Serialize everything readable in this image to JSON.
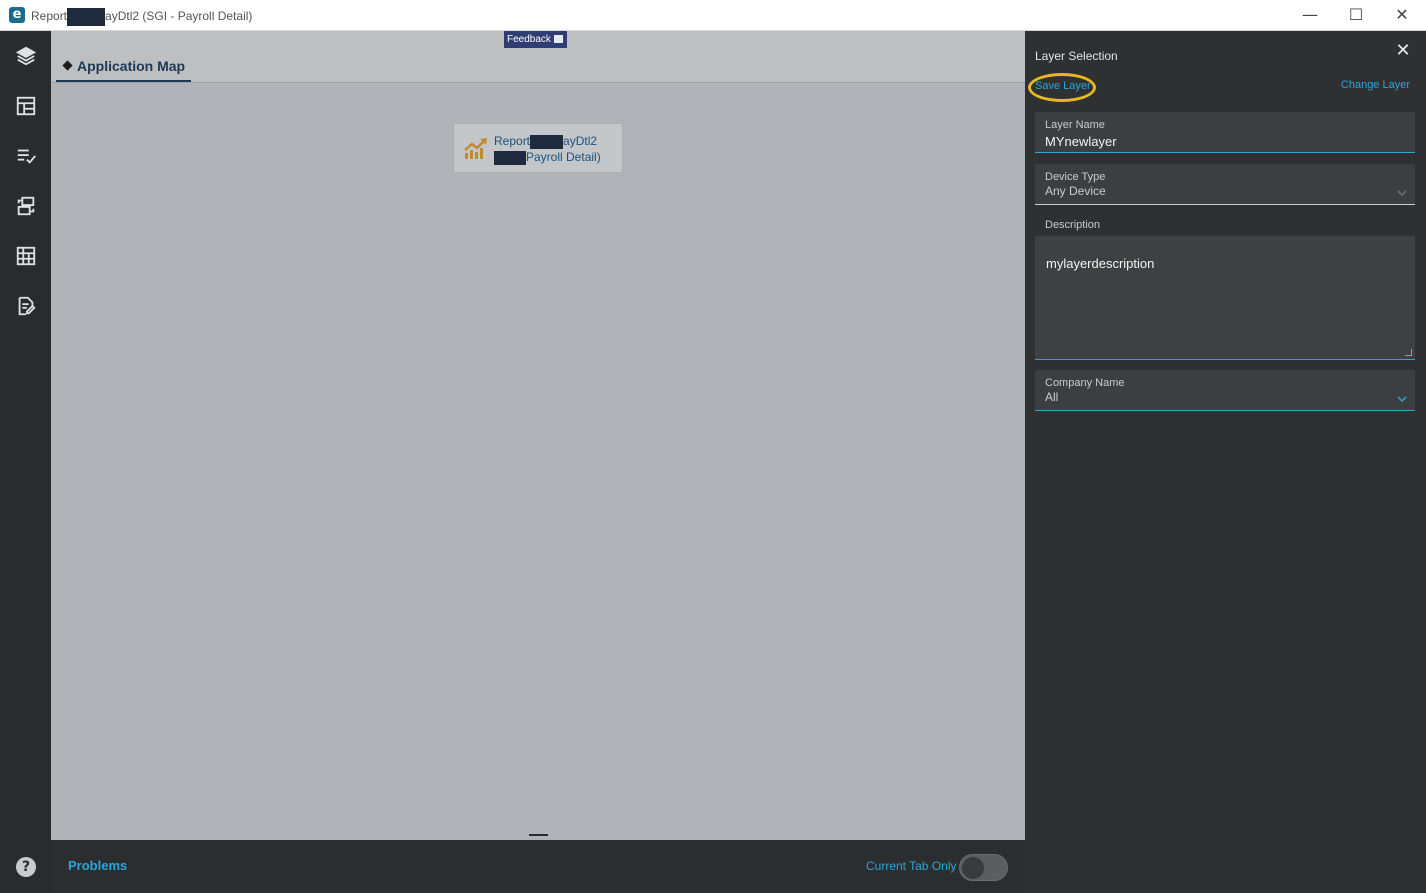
{
  "window": {
    "title_prefix": "Report",
    "title_suffix": "ayDtl2 (SGI - Payroll Detail)",
    "minimize_glyph": "—",
    "maximize_glyph": "☐",
    "close_glyph": "✕",
    "logo_glyph": "e"
  },
  "rail": {
    "icons": [
      "layers-icon",
      "layout-icon",
      "checklist-icon",
      "transfer-icon",
      "table-grid-icon",
      "edit-document-icon"
    ],
    "help_glyph": "?"
  },
  "main": {
    "feedback_label": "Feedback",
    "tab_label": "Application Map",
    "node": {
      "line1_prefix": "Report",
      "line1_suffix": "ayDtl2",
      "line2_suffix": "Payroll Detail)",
      "icon": "trend-up-icon",
      "icon_color": "#c08a2e"
    }
  },
  "bottom": {
    "problems_label": "Problems",
    "current_tab_label": "Current Tab Only",
    "toggle_on": false
  },
  "panel": {
    "title": "Layer Selection",
    "close_glyph": "✕",
    "save_layer": "Save Layer",
    "change_layer": "Change Layer",
    "layer_name": {
      "label": "Layer Name",
      "value": "MYnewlayer"
    },
    "device_type": {
      "label": "Device Type",
      "value": "Any Device"
    },
    "description": {
      "label": "Description",
      "value": "mylayerdescription"
    },
    "company_name": {
      "label": "Company Name",
      "value": "All"
    }
  },
  "colors": {
    "accent": "#2aa6d9",
    "highlight_ring": "#e8b820",
    "rail_bg": "#2a2b2c",
    "panel_bg": "#2f3031"
  }
}
